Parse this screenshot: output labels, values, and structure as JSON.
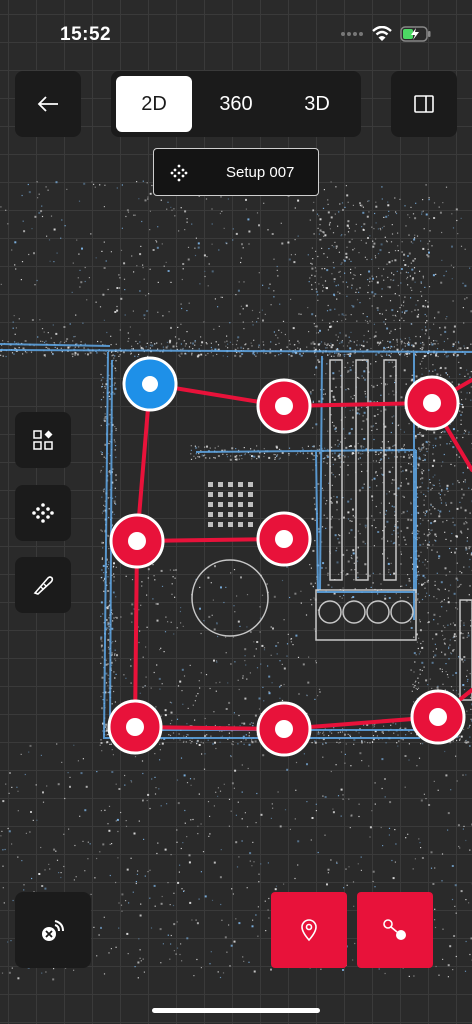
{
  "status": {
    "time": "15:52"
  },
  "view_modes": [
    {
      "label": "2D",
      "active": true
    },
    {
      "label": "360",
      "active": false
    },
    {
      "label": "3D",
      "active": false
    }
  ],
  "setup": {
    "label": "Setup 007"
  },
  "colors": {
    "node_red": "#e8123a",
    "node_selected": "#1e90e8",
    "link_red": "#e8123a",
    "wall_blue": "#5fa8e8",
    "background": "#2a2a2a"
  },
  "icons": {
    "back": "arrow-left-icon",
    "panel_toggle": "sidebar-panel-icon",
    "layers": "layers-icon",
    "scan_points": "scan-points-icon",
    "measure": "ruler-icon",
    "disconnect": "signal-off-icon",
    "add_marker": "location-pin-icon",
    "add_link": "connect-nodes-icon"
  }
}
